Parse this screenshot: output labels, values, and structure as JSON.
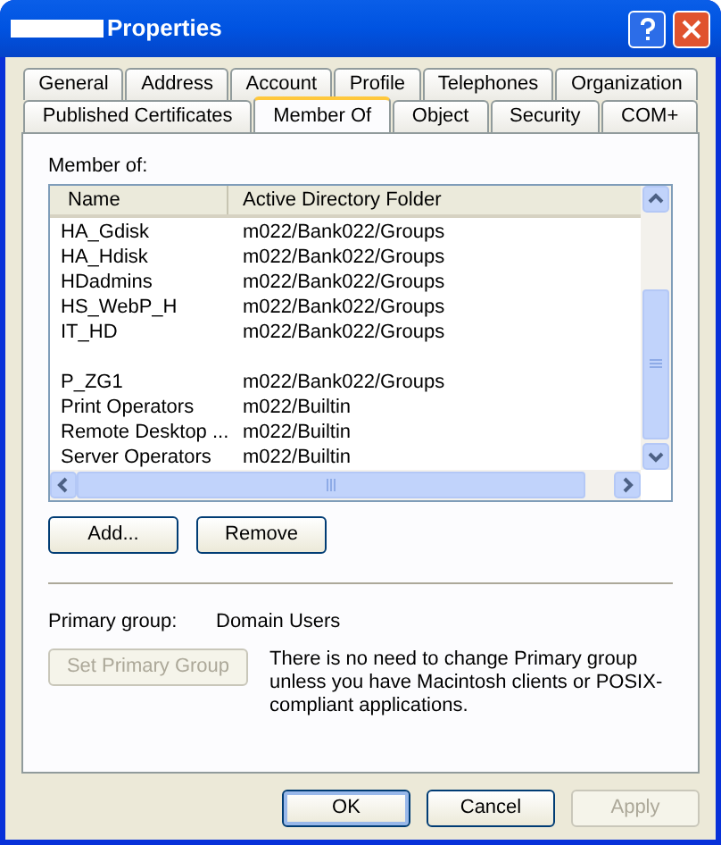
{
  "window": {
    "title": "Properties"
  },
  "tab_rows": [
    [
      {
        "label": "General",
        "selected": false
      },
      {
        "label": "Address",
        "selected": false
      },
      {
        "label": "Account",
        "selected": false
      },
      {
        "label": "Profile",
        "selected": false
      },
      {
        "label": "Telephones",
        "selected": false
      },
      {
        "label": "Organization",
        "selected": false
      }
    ],
    [
      {
        "label": "Published Certificates",
        "selected": false
      },
      {
        "label": "Member Of",
        "selected": true
      },
      {
        "label": "Object",
        "selected": false
      },
      {
        "label": "Security",
        "selected": false
      },
      {
        "label": "COM+",
        "selected": false
      }
    ]
  ],
  "member_of": {
    "label": "Member of:",
    "columns": [
      "Name",
      "Active Directory Folder"
    ],
    "rows": [
      {
        "kind": "entry",
        "name": "HA_Gdisk",
        "folder": "m022/Bank022/Groups"
      },
      {
        "kind": "entry",
        "name": "HA_Hdisk",
        "folder": "m022/Bank022/Groups"
      },
      {
        "kind": "entry",
        "name": "HDadmins",
        "folder": "m022/Bank022/Groups"
      },
      {
        "kind": "entry",
        "name": "HS_WebP_H",
        "folder": "m022/Bank022/Groups"
      },
      {
        "kind": "entry",
        "name": "IT_HD",
        "folder": "m022/Bank022/Groups"
      },
      {
        "kind": "blank"
      },
      {
        "kind": "entry",
        "name": "P_ZG1",
        "folder": "m022/Bank022/Groups"
      },
      {
        "kind": "entry",
        "name": "Print Operators",
        "folder": "m022/Builtin"
      },
      {
        "kind": "entry",
        "name": "Remote Desktop ...",
        "folder": "m022/Builtin"
      },
      {
        "kind": "entry",
        "name": "Server Operators",
        "folder": "m022/Builtin"
      }
    ]
  },
  "list_buttons": [
    {
      "label": "Add...",
      "disabled": false
    },
    {
      "label": "Remove",
      "disabled": false
    }
  ],
  "primary_group": {
    "label": "Primary group:",
    "value": "Domain Users"
  },
  "set_primary_button": {
    "label": "Set Primary Group",
    "disabled": true
  },
  "note": "There is no need to change Primary group unless you have Macintosh clients or POSIX-compliant applications.",
  "dialog_buttons": [
    {
      "label": "OK",
      "disabled": false,
      "default": true
    },
    {
      "label": "Cancel",
      "disabled": false,
      "default": false
    },
    {
      "label": "Apply",
      "disabled": true,
      "default": false
    }
  ]
}
